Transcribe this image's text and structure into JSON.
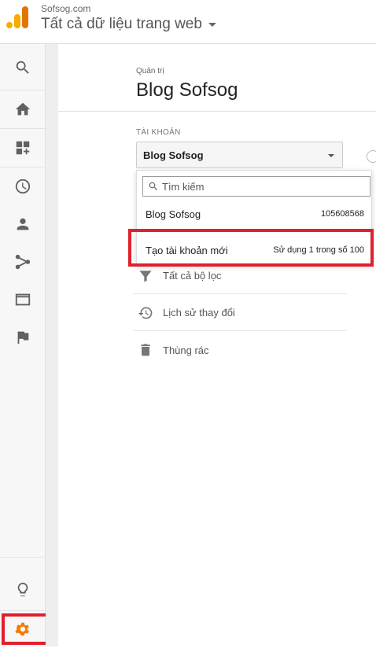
{
  "header": {
    "site_name": "Sofsog.com",
    "property_name": "Tất cả dữ liệu trang web"
  },
  "sidebar": {
    "items": [
      {
        "icon": "search-icon"
      },
      {
        "icon": "home-icon"
      },
      {
        "icon": "dashboard-add-icon"
      },
      {
        "icon": "clock-icon"
      },
      {
        "icon": "person-icon"
      },
      {
        "icon": "acquisition-icon"
      },
      {
        "icon": "behavior-icon"
      },
      {
        "icon": "flag-icon"
      }
    ],
    "bottom": [
      {
        "icon": "lightbulb-icon"
      },
      {
        "icon": "gear-icon"
      }
    ]
  },
  "admin": {
    "crumb": "Quản trị",
    "title": "Blog Sofsog",
    "account_label": "TÀI KHOẢN",
    "account_selected": "Blog Sofsog"
  },
  "dropdown": {
    "search_placeholder": "Tìm kiếm",
    "account_name": "Blog Sofsog",
    "account_id": "105608568",
    "create_label": "Tạo tài khoản mới",
    "usage_text": "Sử dụng 1 trong số 100"
  },
  "menu": [
    {
      "label": "Tất cả bộ lọc",
      "icon": "filter-icon"
    },
    {
      "label": "Lịch sử thay đổi",
      "icon": "history-icon"
    },
    {
      "label": "Thùng rác",
      "icon": "trash-icon"
    }
  ],
  "colors": {
    "highlight": "#e0202c",
    "gear": "#f57c00",
    "logo": "#f9ab00"
  }
}
